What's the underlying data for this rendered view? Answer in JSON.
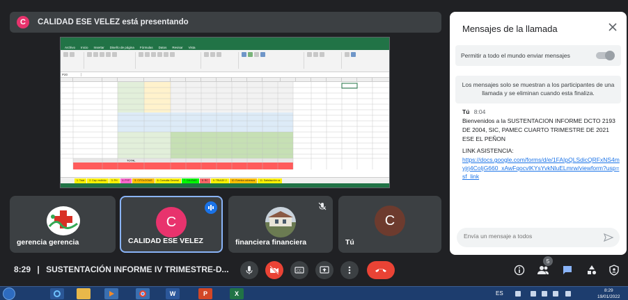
{
  "presenter": {
    "avatar_letter": "C",
    "banner_text": "CALIDAD ESE VELEZ está presentando",
    "avatar_color": "#e8336d"
  },
  "excel": {
    "window_title": "",
    "menu_tabs": [
      "Archivo",
      "Inicio",
      "Insertar",
      "Diseño de página",
      "Fórmulas",
      "Datos",
      "Revisar",
      "Vista"
    ],
    "name_box": "P20",
    "table_label": "TOTAL",
    "sheet_tabs": [
      {
        "label": "1. Total",
        "color": "#fff200"
      },
      {
        "label": "2. Cap. recibido",
        "color": "#fff200"
      },
      {
        "label": "3. PH",
        "color": "#fff200"
      },
      {
        "label": "4. PYP",
        "color": "#ff66cc"
      },
      {
        "label": "5. CITOLOGIAS",
        "color": "#ffc000"
      },
      {
        "label": "6. Consulta General",
        "color": "#fff200"
      },
      {
        "label": "7. CALIDAD",
        "color": "#00ff00"
      },
      {
        "label": "8. RC",
        "color": "#ff6666"
      },
      {
        "label": "9. TRIAGE 2",
        "color": "#fff200"
      },
      {
        "label": "10. Eventos adversos",
        "color": "#ffc000"
      },
      {
        "label": "11. Satisfacción us",
        "color": "#fff200"
      }
    ]
  },
  "tiles": [
    {
      "name": "gerencia gerencia",
      "type": "logo"
    },
    {
      "name": "CALIDAD ESE VELEZ",
      "avatar_letter": "C",
      "avatar_color": "#e8336d",
      "speaking": true
    },
    {
      "name": "financiera financiera",
      "type": "photo",
      "muted": true
    },
    {
      "name": "Tú",
      "avatar_letter": "C",
      "avatar_color": "#6d3b2e"
    }
  ],
  "meeting": {
    "time": "8:29",
    "separator": "|",
    "title": "SUSTENTACIÓN INFORME IV TRIMESTRE-D..."
  },
  "controls": [
    "mic-icon",
    "camera-off-icon",
    "captions-icon",
    "present-icon",
    "more-options-icon",
    "hangup-icon"
  ],
  "right_controls": [
    "info-icon",
    "people-icon",
    "chat-icon",
    "activities-icon",
    "safety-icon"
  ],
  "people_count": "5",
  "chat": {
    "title": "Mensajes de la llamada",
    "allow_label": "Permitir a todo el mundo enviar mensajes",
    "info": "Los mensajes solo se muestran a los participantes de una llamada y se eliminan cuando esta finaliza.",
    "message": {
      "sender": "Tú",
      "time": "8:04",
      "body": "Bienvenidos a la SUSTENTACION INFORME DCTO 2193 DE 2004, SIC, PAMEC CUARTO TRIMESTRE DE 2021 ESE EL PEÑON",
      "link_label": "LINK ASISTENCIA:",
      "link": "https://docs.google.com/forms/d/e/1FAIpQLSdicQRFxNS4myjrj4CoIjG660_xAwFqocvlKYsYvkNluELmrw/viewform?usp=sf_link"
    },
    "input_placeholder": "Envía un mensaje a todos"
  },
  "taskbar": {
    "lang": "ES",
    "clock_time": "8:29",
    "clock_date": "19/01/2022"
  }
}
